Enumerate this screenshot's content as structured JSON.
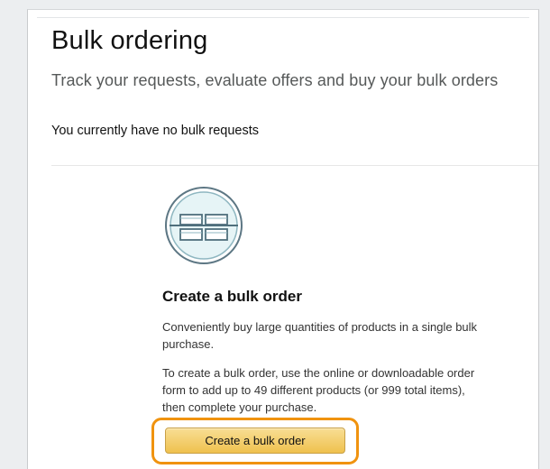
{
  "page": {
    "title": "Bulk ordering",
    "subtitle": "Track your requests, evaluate offers and buy your bulk orders"
  },
  "requests": {
    "status_text": "You currently have no bulk requests"
  },
  "create_section": {
    "illustration_icon": "boxes-grid-icon",
    "title": "Create a bulk order",
    "description_1": "Conveniently buy large quantities of products in a single bulk purchase.",
    "description_2": "To create a bulk order, use the online or downloadable order form to add up to 49 different products (or 999 total items), then complete your purchase.",
    "button_label": "Create a bulk order"
  },
  "colors": {
    "button_gradient_top": "#f8de94",
    "button_gradient_bottom": "#efc14e",
    "highlight_outline": "#f0930f",
    "illustration_fill": "#e8f5f7",
    "illustration_stroke": "#4f6f7c"
  }
}
